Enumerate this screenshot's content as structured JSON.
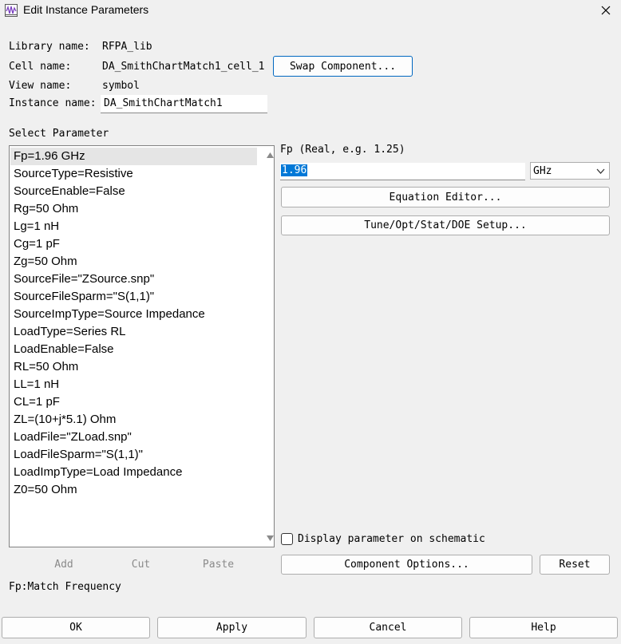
{
  "window": {
    "title": "Edit Instance Parameters",
    "icon": "waveform-app-icon"
  },
  "info": {
    "library_label": "Library name:",
    "library_value": "RFPA_lib",
    "cell_label": "Cell name:",
    "cell_value": "DA_SmithChartMatch1_cell_1",
    "swap_button": "Swap Component...",
    "view_label": "View name:",
    "view_value": "symbol",
    "instance_label": "Instance name:",
    "instance_value": "DA_SmithChartMatch1"
  },
  "params": {
    "section_label": "Select Parameter",
    "items": [
      "Fp=1.96 GHz",
      "SourceType=Resistive",
      "SourceEnable=False",
      "Rg=50 Ohm",
      "Lg=1 nH",
      "Cg=1 pF",
      "Zg=50 Ohm",
      "SourceFile=\"ZSource.snp\"",
      "SourceFileSparm=\"S(1,1)\"",
      "SourceImpType=Source Impedance",
      "LoadType=Series RL",
      "LoadEnable=False",
      "RL=50 Ohm",
      "LL=1 nH",
      "CL=1 pF",
      "ZL=(10+j*5.1) Ohm",
      "LoadFile=\"ZLoad.snp\"",
      "LoadFileSparm=\"S(1,1)\"",
      "LoadImpType=Load Impedance",
      "Z0=50 Ohm"
    ],
    "selected_index": 0,
    "add_label": "Add",
    "cut_label": "Cut",
    "paste_label": "Paste"
  },
  "editor": {
    "param_desc": "Fp (Real, e.g. 1.25)",
    "value": "1.96",
    "unit": "GHz",
    "equation_editor": "Equation Editor...",
    "tune_setup": "Tune/Opt/Stat/DOE Setup...",
    "display_checkbox_label": "Display parameter on schematic",
    "display_checked": false,
    "component_options": "Component Options...",
    "reset": "Reset"
  },
  "description": "Fp:Match Frequency",
  "footer": {
    "ok": "OK",
    "apply": "Apply",
    "cancel": "Cancel",
    "help": "Help"
  },
  "colors": {
    "accent": "#0067c0",
    "selection": "#0078d7",
    "list_selected": "#e5e5e5"
  }
}
